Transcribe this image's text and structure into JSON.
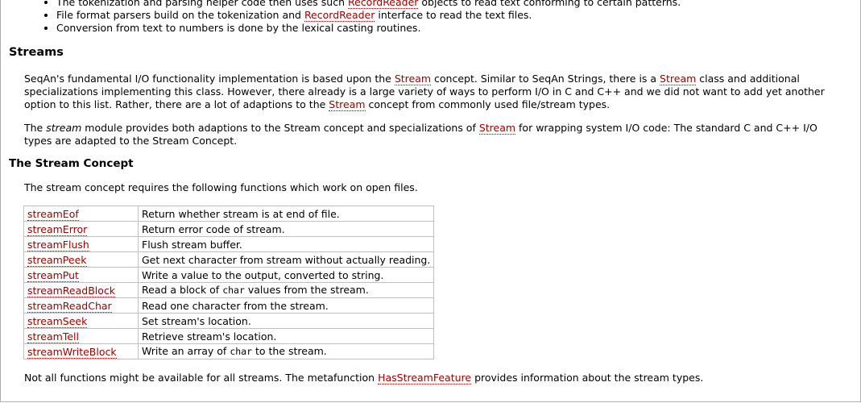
{
  "bullets": [
    {
      "pre": "The tokenization and parsing helper code then uses such ",
      "link": "RecordReader",
      "post": " objects to read text conforming to certain patterns."
    },
    {
      "pre": "File format parsers build on the tokenization and ",
      "link": "RecordReader",
      "post": " interface to read the text files."
    },
    {
      "pre": "Conversion from text to numbers is done by the lexical casting routines.",
      "link": "",
      "post": ""
    }
  ],
  "streams_heading": "Streams",
  "para1": {
    "t1": "SeqAn's fundamental I/O functionality implementation is based upon the ",
    "l1": "Stream",
    "t2": " concept. Similar to SeqAn Strings, there is a ",
    "l2": "Stream",
    "t3": " class and additional specializations implementing this class. However, there already is a large variety of ways to perform I/O in C and C++ and we did not want to add yet another option to this list. Rather, there are a lot of adaptions to the ",
    "l3": "Stream",
    "t4": " concept from commonly used file/stream types."
  },
  "para2": {
    "t1": "The ",
    "em": "stream",
    "t2": " module provides both adaptions to the Stream concept and specializations of ",
    "l1": "Stream",
    "t3": " for wrapping system I/O code: The standard C and C++ I/O types are adapted to the Stream Concept."
  },
  "concept_heading": "The Stream Concept",
  "concept_intro": "The stream concept requires the following functions which work on open files.",
  "functions": [
    {
      "name": "streamEof",
      "d1": "Return whether stream is at end of file.",
      "code": "",
      "d2": ""
    },
    {
      "name": "streamError",
      "d1": "Return error code of stream.",
      "code": "",
      "d2": ""
    },
    {
      "name": "streamFlush",
      "d1": "Flush stream buffer.",
      "code": "",
      "d2": ""
    },
    {
      "name": "streamPeek",
      "d1": "Get next character from stream without actually reading.",
      "code": "",
      "d2": ""
    },
    {
      "name": "streamPut",
      "d1": "Write a value to the output, converted to string.",
      "code": "",
      "d2": ""
    },
    {
      "name": "streamReadBlock",
      "d1": "Read a block of ",
      "code": "char",
      "d2": " values from the stream."
    },
    {
      "name": "streamReadChar",
      "d1": "Read one character from the stream.",
      "code": "",
      "d2": ""
    },
    {
      "name": "streamSeek",
      "d1": "Set stream's location.",
      "code": "",
      "d2": ""
    },
    {
      "name": "streamTell",
      "d1": "Retrieve stream's location.",
      "code": "",
      "d2": ""
    },
    {
      "name": "streamWriteBlock",
      "d1": "Write an array of ",
      "code": "char",
      "d2": " to the stream."
    }
  ],
  "para3": {
    "t1": "Not all functions might be available for all streams. The metafunction ",
    "l1": "HasStreamFeature",
    "t2": " provides information about the stream types."
  },
  "colors": {
    "link": "#a00000"
  }
}
